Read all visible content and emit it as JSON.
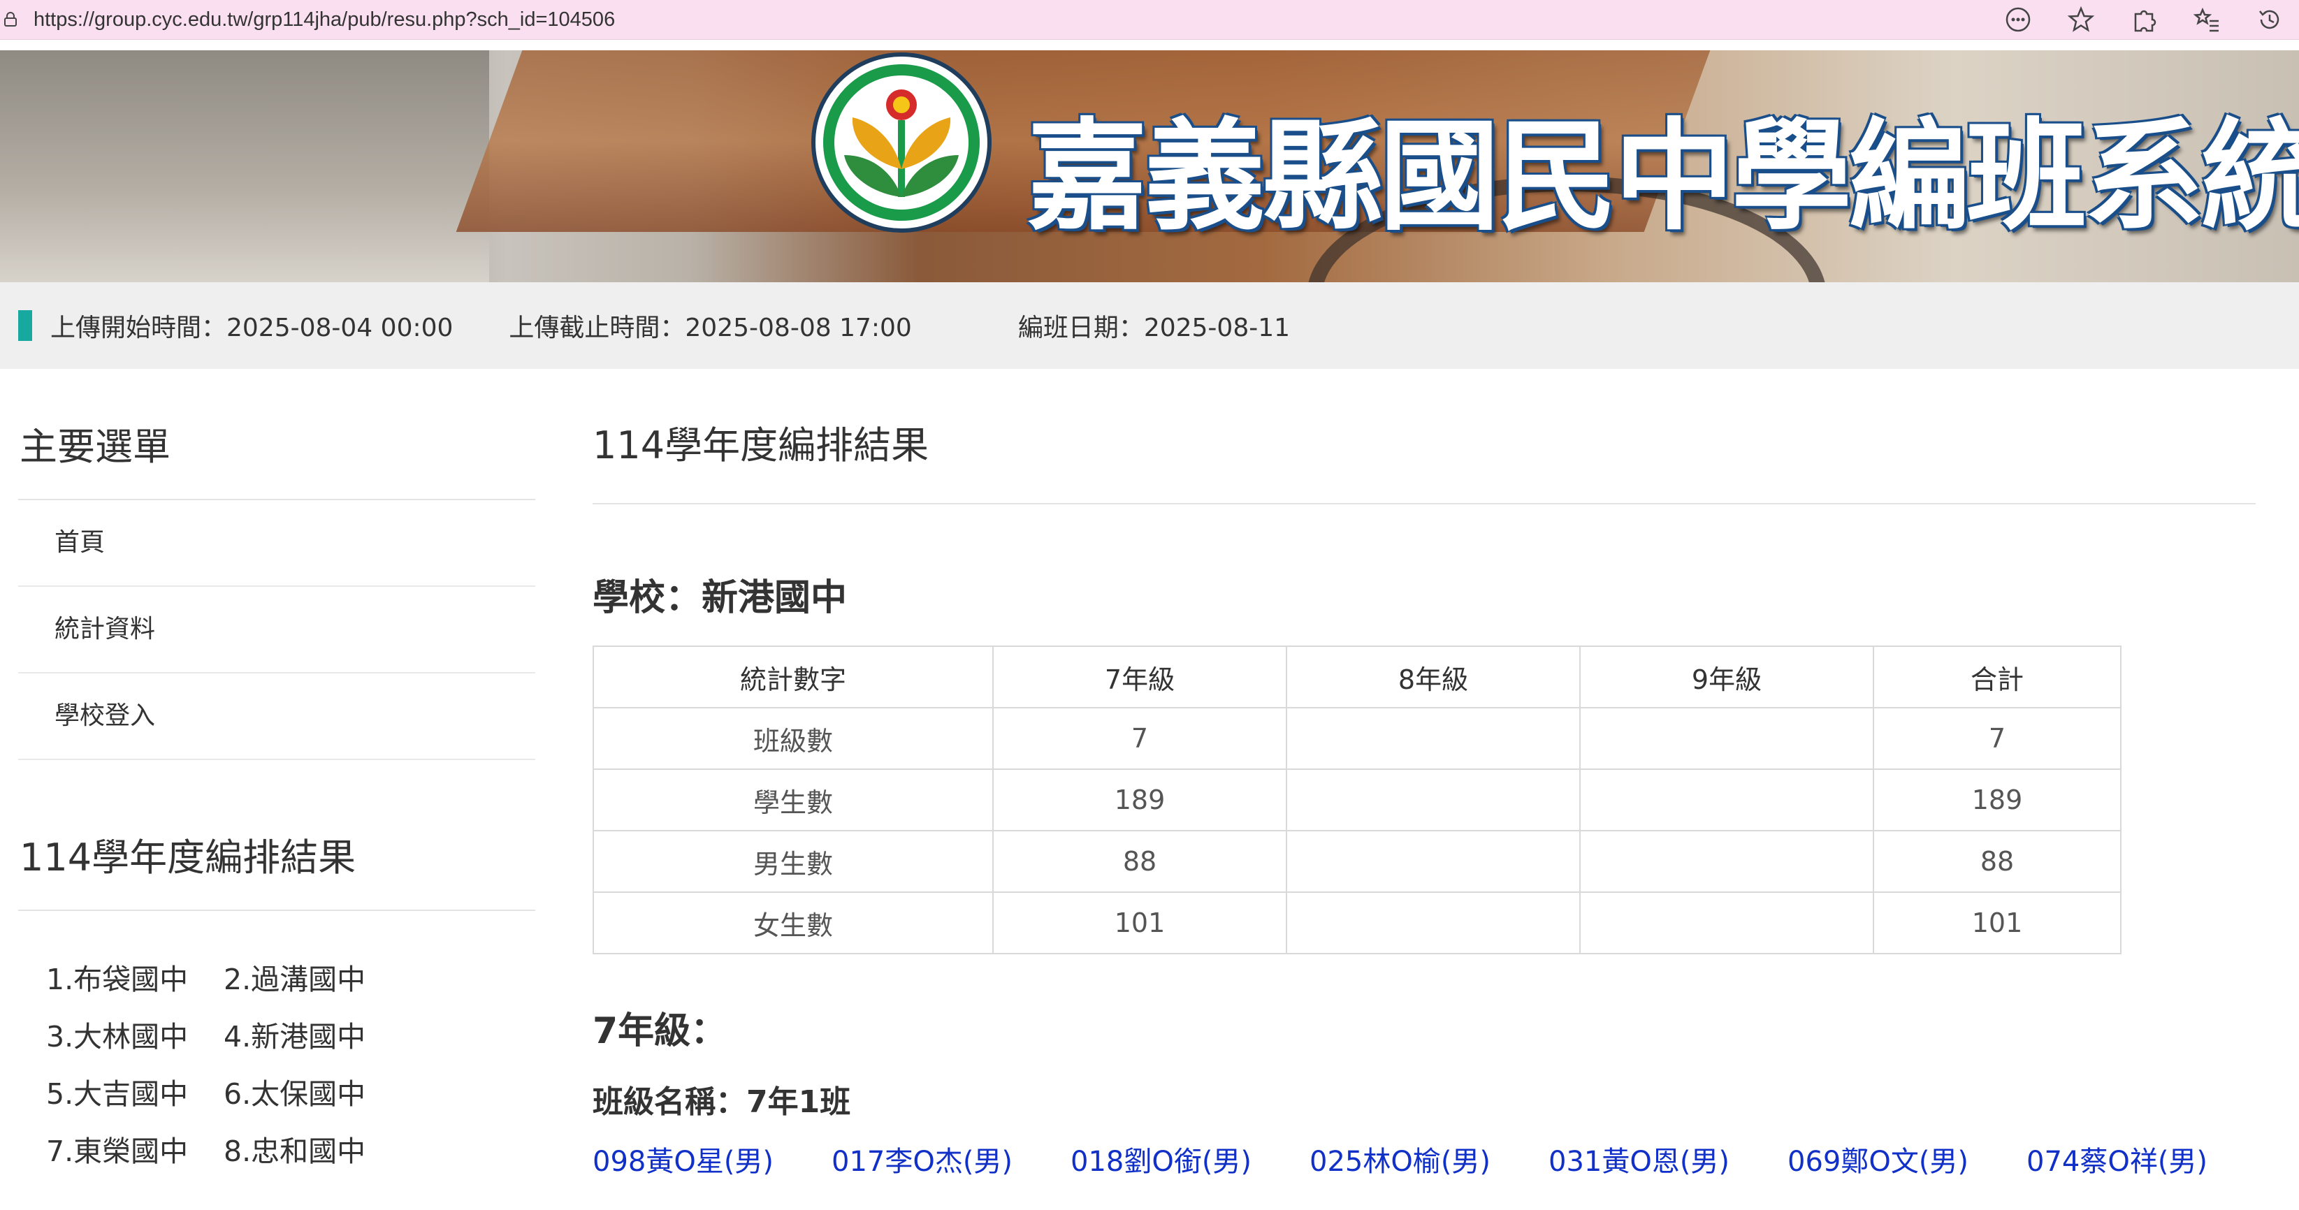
{
  "browser": {
    "url": "https://group.cyc.edu.tw/grp114jha/pub/resu.php?sch_id=104506"
  },
  "banner": {
    "title_part1": "嘉義縣國民中學",
    "title_part2": "編班系統"
  },
  "info": {
    "upload_start": "上傳開始時間：2025-08-04 00:00",
    "upload_end": "上傳截止時間：2025-08-08 17:00",
    "class_date": "編班日期：2025-08-11"
  },
  "sidebar": {
    "menu_title": "主要選單",
    "menu_items": [
      "首頁",
      "統計資料",
      "學校登入"
    ],
    "results_title": "114學年度編排結果",
    "schools": [
      [
        "1.布袋國中",
        "2.過溝國中"
      ],
      [
        "3.大林國中",
        "4.新港國中"
      ],
      [
        "5.大吉國中",
        "6.太保國中"
      ],
      [
        "7.東榮國中",
        "8.忠和國中"
      ]
    ]
  },
  "main": {
    "title": "114學年度編排結果",
    "school": "學校：新港國中",
    "table": {
      "headers": [
        "統計數字",
        "7年級",
        "8年級",
        "9年級",
        "合計"
      ],
      "rows": [
        [
          "班級數",
          "7",
          "",
          "",
          "7"
        ],
        [
          "學生數",
          "189",
          "",
          "",
          "189"
        ],
        [
          "男生數",
          "88",
          "",
          "",
          "88"
        ],
        [
          "女生數",
          "101",
          "",
          "",
          "101"
        ]
      ]
    },
    "grade_label": "7年級：",
    "class_label": "班級名稱：7年1班",
    "students": [
      "098黃O星(男)",
      "017李O杰(男)",
      "018劉O銜(男)",
      "025林O榆(男)",
      "031黃O恩(男)",
      "069鄭O文(男)",
      "074蔡O祥(男)"
    ]
  },
  "colors": {
    "accent_teal": "#17a9a0",
    "link_blue": "#1030c8",
    "address_bar": "#f9dff0"
  }
}
